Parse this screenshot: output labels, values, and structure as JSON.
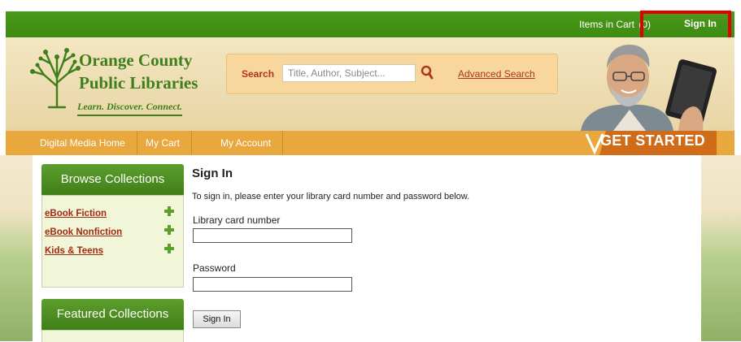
{
  "topbar": {
    "cart_label": "Items in Cart",
    "cart_count": "(0)",
    "signin_label": "Sign In"
  },
  "logo": {
    "line1": "Orange County",
    "line2": "Public Libraries",
    "tagline": "Learn. Discover. Connect."
  },
  "search": {
    "label": "Search",
    "placeholder": "Title, Author, Subject...",
    "advanced_label": "Advanced Search"
  },
  "nav": {
    "items": [
      "Digital Media Home",
      "My Cart",
      "My Account"
    ],
    "get_started": "GET STARTED"
  },
  "sidebar": {
    "browse_title": "Browse Collections",
    "collections": [
      "eBook Fiction",
      "eBook Nonfiction",
      "Kids & Teens"
    ],
    "featured_title": "Featured Collections"
  },
  "form": {
    "title": "Sign In",
    "description": "To sign in, please enter your library card number and password below.",
    "card_label": "Library card number",
    "password_label": "Password",
    "submit_label": "Sign In"
  },
  "colors": {
    "brand_green": "#3e7f1c",
    "nav_orange": "#e9a83d",
    "link_red": "#a12a10",
    "highlight_red": "#e00000"
  }
}
